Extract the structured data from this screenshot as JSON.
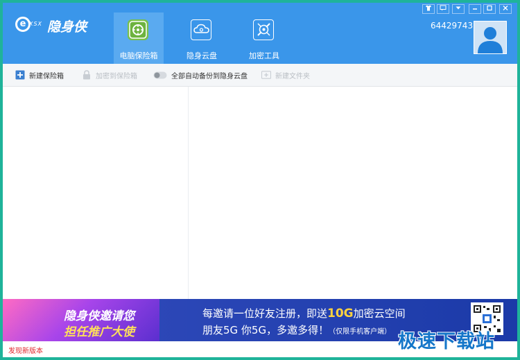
{
  "app": {
    "logo_prefix": "e",
    "logo_sub": "XSX",
    "logo_name": "隐身侠"
  },
  "nav": {
    "tabs": [
      {
        "label": "电脑保险箱",
        "icon": "safe-icon",
        "active": true
      },
      {
        "label": "隐身云盘",
        "icon": "cloud-icon",
        "active": false
      },
      {
        "label": "加密工具",
        "icon": "tools-icon",
        "active": false
      }
    ]
  },
  "window_controls": [
    {
      "icon": "skin-icon",
      "glyph": "👕"
    },
    {
      "icon": "message-icon",
      "glyph": "▭"
    },
    {
      "icon": "menu-icon",
      "glyph": "▼"
    },
    {
      "icon": "minimize-icon",
      "glyph": "—"
    },
    {
      "icon": "maximize-icon",
      "glyph": "□"
    },
    {
      "icon": "close-icon",
      "glyph": "✕"
    }
  ],
  "account": {
    "id": "64429743",
    "avatar_icon": "user-avatar-icon"
  },
  "toolbar": {
    "new_safe": "新建保险箱",
    "encrypt_to_safe": "加密到保险箱",
    "auto_backup": "全部自动备份到隐身云盘",
    "auto_backup_on": false,
    "new_folder": "新建文件夹"
  },
  "banner": {
    "promo_line1": "隐身侠邀请您",
    "promo_line2": "担任推广大使",
    "line1_a": "每邀请一位好友注册，即送",
    "line1_highlight": "10G",
    "line1_b": "加密云空间",
    "line2_main": "朋友5G  你5G，多邀多得！",
    "line2_note": "（仅限手机客户端）"
  },
  "status": {
    "text": "发现新版本"
  },
  "watermark": "极速下载站",
  "colors": {
    "header_bg": "#3a96ea",
    "active_tab_bg": "#5aaaf0",
    "safe_green": "#79c04a",
    "toolbar_bg": "#f4f6f8",
    "status_red": "#e0262b",
    "frame_teal": "#1fb39a"
  }
}
